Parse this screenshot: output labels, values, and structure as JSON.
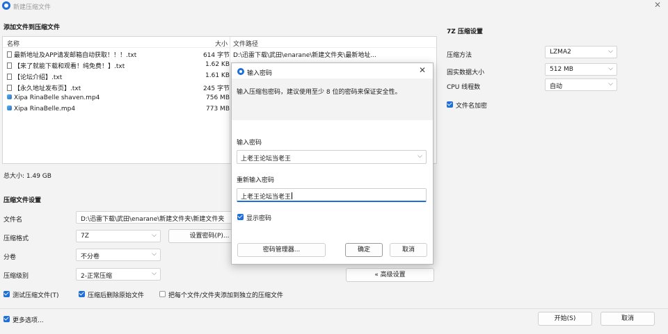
{
  "window": {
    "title": "新建压缩文件",
    "close": "✕"
  },
  "files": {
    "section_title": "添加文件到压缩文件",
    "columns": {
      "name": "名称",
      "size": "大小",
      "path": "文件路径"
    },
    "rows": [
      {
        "name": "最新地址及APP请发邮箱自动获取！！！.txt",
        "size": "614 字节",
        "path": "D:\\迅雷下载\\武田\\enarane\\新建文件夹\\最新地址...",
        "icon": "document-icon"
      },
      {
        "name": "【来了就能下载和观看！纯免费！】.txt",
        "size": "1.62 KB",
        "path": "",
        "icon": "document-icon"
      },
      {
        "name": "【论坛介绍】.txt",
        "size": "1.61 KB",
        "path": "",
        "icon": "document-icon"
      },
      {
        "name": "【永久地址发布页】.txt",
        "size": "245 字节",
        "path": "",
        "icon": "document-icon"
      },
      {
        "name": "Xipa RinaBelle shaven.mp4",
        "size": "756 MB",
        "path": "",
        "icon": "video-icon"
      },
      {
        "name": "Xipa RinaBelle.mp4",
        "size": "773 MB",
        "path": "",
        "icon": "video-icon"
      }
    ],
    "total": "总大小: 1.49 GB"
  },
  "settings": {
    "section_title": "压缩文件设置",
    "filename_label": "文件名",
    "filename_value": "D:\\迅雷下载\\武田\\enarane\\新建文件夹\\新建文件夹",
    "format_label": "压缩格式",
    "format_value": "7Z",
    "set_password_label": "设置密码(P)...",
    "split_label": "分卷",
    "split_value": "不分卷",
    "level_label": "压缩级别",
    "level_value": "2-正常压缩",
    "advanced_label": "« 高级设置",
    "test_archive_label": "测试压缩文件(T)",
    "delete_after_label": "压缩后删除原始文件",
    "separate_archives_label": "把每个文件/文件夹添加到独立的压缩文件",
    "more_options_label": "更多选项..."
  },
  "seven_z": {
    "section_title": "7Z 压缩设置",
    "method_label": "压缩方法",
    "method_value": "LZMA2",
    "dict_label": "固实数据大小",
    "dict_value": "512 MB",
    "cpu_label": "CPU 线程数",
    "cpu_value": "自动",
    "encrypt_names_label": "文件名加密"
  },
  "bottom": {
    "start_label": "开始(S)",
    "cancel_label": "取消"
  },
  "dialog": {
    "title": "输入密码",
    "close": "✕",
    "hint": "输入压缩包密码，建议使用至少 8 位的密码来保证安全性。",
    "password_label": "输入密码",
    "password_value": "上老王论坛当老王",
    "repeat_label": "重新输入密码",
    "repeat_value": "上老王论坛当老王",
    "show_password_label": "显示密码",
    "manager_label": "密码管理器...",
    "ok_label": "确定",
    "cancel_label": "取消"
  }
}
